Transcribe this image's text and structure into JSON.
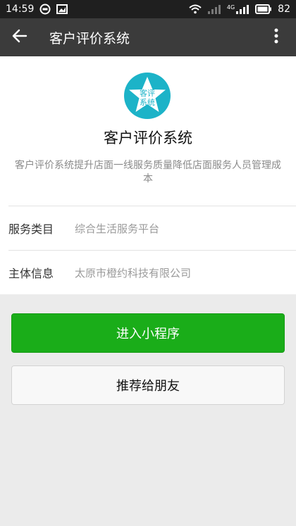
{
  "status_bar": {
    "time": "14:59",
    "network": "4G",
    "battery": "82",
    "icons": [
      "notification-circle-icon",
      "image-icon",
      "wifi-icon",
      "signal-weak-icon",
      "signal-icon",
      "battery-icon"
    ]
  },
  "app_bar": {
    "title": "客户评价系统",
    "back_icon": "arrow-left-icon",
    "more_icon": "more-vertical-icon"
  },
  "profile": {
    "logo_text_line1": "客评",
    "logo_text_line2": "系统",
    "logo_color": "#1cb3c8",
    "name": "客户评价系统",
    "description": "客户评价系统提升店面一线服务质量降低店面服务人员管理成本"
  },
  "info": {
    "service_category_label": "服务类目",
    "service_category_value": "综合生活服务平台",
    "entity_label": "主体信息",
    "entity_value": "太原市橙约科技有限公司"
  },
  "actions": {
    "enter_label": "进入小程序",
    "recommend_label": "推荐给朋友"
  },
  "colors": {
    "primary_button": "#1aad19",
    "app_bar": "#3b3b3b",
    "status_bar": "#1f1f1f",
    "background": "#ebebeb"
  }
}
